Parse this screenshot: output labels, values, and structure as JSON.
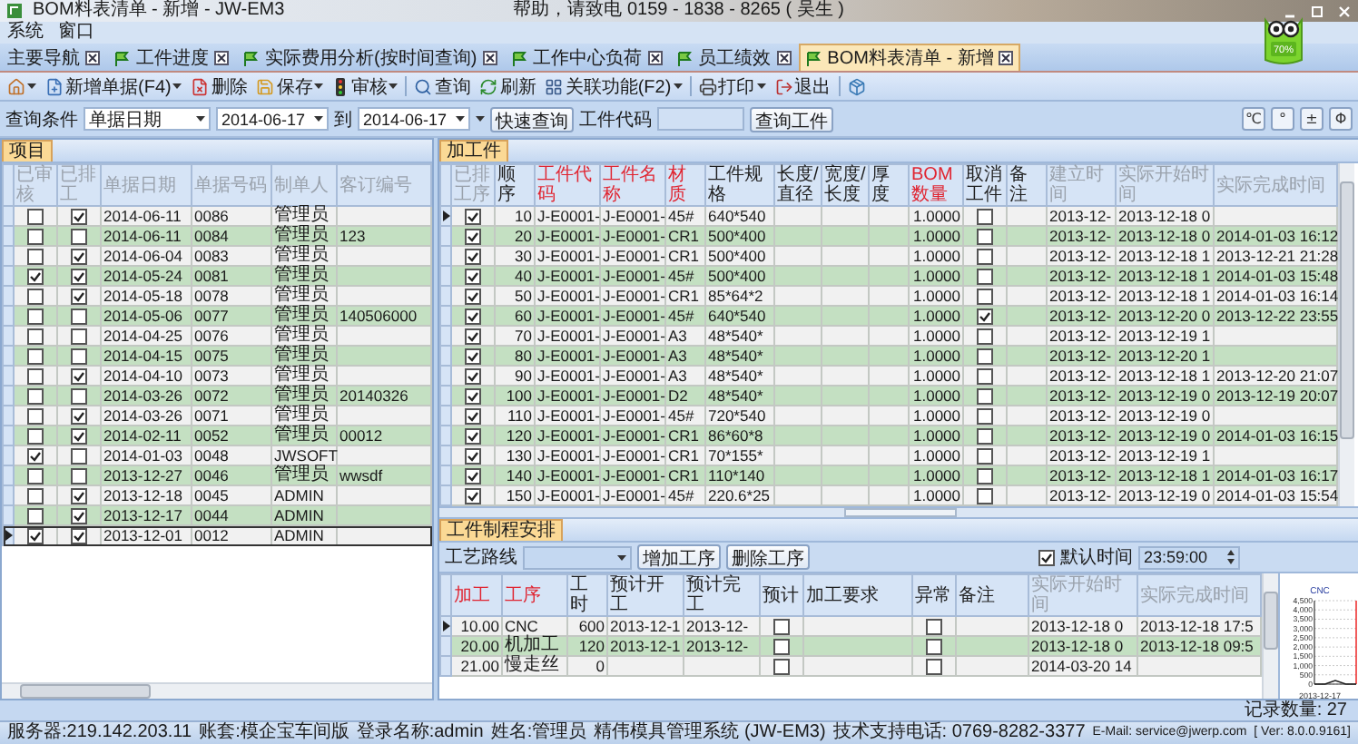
{
  "window": {
    "title": "BOM料表清单 - 新增 - JW-EM3",
    "help": "帮助，请致电 0159 - 1838 - 8265 ( 吴生 )"
  },
  "menu": [
    "系统",
    "窗口"
  ],
  "mascot": {
    "badge": "70%"
  },
  "tabs": [
    {
      "label": "主要导航",
      "icon": false,
      "selected": false
    },
    {
      "label": "工件进度",
      "icon": true,
      "selected": false
    },
    {
      "label": "实际费用分析(按时间查询)",
      "icon": true,
      "selected": false
    },
    {
      "label": "工作中心负荷",
      "icon": true,
      "selected": false
    },
    {
      "label": "员工绩效",
      "icon": true,
      "selected": false
    },
    {
      "label": "BOM料表清单 - 新增",
      "icon": true,
      "selected": true
    }
  ],
  "toolbar": [
    {
      "kind": "button",
      "menu": true
    },
    {
      "kind": "button",
      "label": "新增单据(F4)",
      "menu": true
    },
    {
      "kind": "button",
      "label": "删除",
      "menu": false
    },
    {
      "kind": "button",
      "label": "保存",
      "menu": true
    },
    {
      "kind": "button",
      "label": "审核",
      "menu": true
    },
    {
      "kind": "separator"
    },
    {
      "kind": "button",
      "label": "查询",
      "menu": false
    },
    {
      "kind": "button",
      "label": "刷新",
      "menu": false
    },
    {
      "kind": "button",
      "label": "关联功能(F2)",
      "menu": true
    },
    {
      "kind": "separator"
    },
    {
      "kind": "button",
      "label": "打印",
      "menu": true
    },
    {
      "kind": "button",
      "label": "退出",
      "menu": false
    },
    {
      "kind": "separator"
    },
    {
      "kind": "button",
      "menu": false
    }
  ],
  "query": {
    "label": "查询条件",
    "field": "单据日期",
    "from": "2014-06-17",
    "to_label": "到",
    "to": "2014-06-17",
    "quick_button": "快速查询",
    "code_label": "工件代码",
    "code_button": "查询工件",
    "tools": [
      "℃",
      "°",
      "±",
      "Φ"
    ]
  },
  "projects": {
    "tab": "项目",
    "columns": [
      {
        "label": "已审核",
        "color": "#9aa2ac"
      },
      {
        "label": "已排工",
        "color": "#9aa2ac"
      },
      {
        "label": "单据日期",
        "color": "#9aa2ac"
      },
      {
        "label": "单据号码",
        "color": "#9aa2ac"
      },
      {
        "label": "制单人",
        "color": "#9aa2ac"
      },
      {
        "label": "客订编号",
        "color": "#9aa2ac"
      }
    ],
    "rows": [
      {
        "selected": false,
        "approved": false,
        "scheduled": true,
        "date": "2014-06-11",
        "number": "0086",
        "maker": "管理员"
      },
      {
        "selected": false,
        "approved": false,
        "scheduled": false,
        "date": "2014-06-11",
        "number": "0084",
        "maker": "管理员",
        "order_no": "123"
      },
      {
        "selected": false,
        "approved": false,
        "scheduled": true,
        "date": "2014-06-04",
        "number": "0083",
        "maker": "管理员"
      },
      {
        "selected": false,
        "approved": true,
        "scheduled": true,
        "date": "2014-05-24",
        "number": "0081",
        "maker": "管理员"
      },
      {
        "selected": false,
        "approved": false,
        "scheduled": true,
        "date": "2014-05-18",
        "number": "0078",
        "maker": "管理员"
      },
      {
        "selected": false,
        "approved": false,
        "scheduled": false,
        "date": "2014-05-06",
        "number": "0077",
        "maker": "管理员",
        "order_no": "140506000"
      },
      {
        "selected": false,
        "approved": false,
        "scheduled": false,
        "date": "2014-04-25",
        "number": "0076",
        "maker": "管理员"
      },
      {
        "selected": false,
        "approved": false,
        "scheduled": false,
        "date": "2014-04-15",
        "number": "0075",
        "maker": "管理员"
      },
      {
        "selected": false,
        "approved": false,
        "scheduled": true,
        "date": "2014-04-10",
        "number": "0073",
        "maker": "管理员"
      },
      {
        "selected": false,
        "approved": false,
        "scheduled": false,
        "date": "2014-03-26",
        "number": "0072",
        "maker": "管理员",
        "order_no": "20140326"
      },
      {
        "selected": false,
        "approved": false,
        "scheduled": true,
        "date": "2014-03-26",
        "number": "0071",
        "maker": "管理员"
      },
      {
        "selected": false,
        "approved": false,
        "scheduled": true,
        "date": "2014-02-11",
        "number": "0052",
        "maker": "管理员",
        "order_no": "00012"
      },
      {
        "selected": false,
        "approved": true,
        "scheduled": false,
        "date": "2014-01-03",
        "number": "0048",
        "maker": "JWSOFT"
      },
      {
        "selected": false,
        "approved": false,
        "scheduled": false,
        "date": "2013-12-27",
        "number": "0046",
        "maker": "管理员",
        "order_no": "wwsdf"
      },
      {
        "selected": false,
        "approved": false,
        "scheduled": true,
        "date": "2013-12-18",
        "number": "0045",
        "maker": "ADMIN"
      },
      {
        "selected": false,
        "approved": false,
        "scheduled": true,
        "date": "2013-12-17",
        "number": "0044",
        "maker": "ADMIN"
      },
      {
        "selected": true,
        "approved": true,
        "scheduled": true,
        "date": "2013-12-01",
        "number": "0012",
        "maker": "ADMIN"
      }
    ]
  },
  "parts": {
    "tab": "加工件",
    "columns": [
      {
        "label": "已排工序",
        "color": "#9aa2ac"
      },
      {
        "label": "顺序",
        "color": "#1f1f1f"
      },
      {
        "label": "工件代码",
        "color": "#e02531"
      },
      {
        "label": "工件名称",
        "color": "#e02531"
      },
      {
        "label": "材质",
        "color": "#e02531"
      },
      {
        "label": "工件规格",
        "color": "#1f1f1f"
      },
      {
        "label": "长度/直径",
        "color": "#1f1f1f"
      },
      {
        "label": "宽度/长度",
        "color": "#1f1f1f"
      },
      {
        "label": "厚度",
        "color": "#1f1f1f"
      },
      {
        "label": "BOM数量",
        "color": "#e02531"
      },
      {
        "label": "取消工件",
        "color": "#1f1f1f"
      },
      {
        "label": "备注",
        "color": "#1f1f1f"
      },
      {
        "label": "建立时间",
        "color": "#9aa2ac"
      },
      {
        "label": "实际开始时间",
        "color": "#9aa2ac"
      },
      {
        "label": "实际完成时间",
        "color": "#9aa2ac"
      }
    ],
    "rows": [
      {
        "selected": true,
        "scheduled": true,
        "seq": "10",
        "code": "J-E0001-",
        "name": "J-E0001-",
        "material": "45#",
        "spec": "640*540",
        "bom_qty": "1.0000",
        "cancelled": false,
        "created": "2013-12-",
        "started": "2013-12-18 0"
      },
      {
        "selected": false,
        "scheduled": true,
        "seq": "20",
        "code": "J-E0001-",
        "name": "J-E0001-",
        "material": "CR1",
        "spec": "500*400",
        "bom_qty": "1.0000",
        "cancelled": false,
        "created": "2013-12-",
        "started": "2013-12-18 0",
        "finished": "2014-01-03 16:12"
      },
      {
        "selected": false,
        "scheduled": true,
        "seq": "30",
        "code": "J-E0001-",
        "name": "J-E0001-",
        "material": "CR1",
        "spec": "500*400",
        "bom_qty": "1.0000",
        "cancelled": false,
        "created": "2013-12-",
        "started": "2013-12-18 1",
        "finished": "2013-12-21 21:28"
      },
      {
        "selected": false,
        "scheduled": true,
        "seq": "40",
        "code": "J-E0001-",
        "name": "J-E0001-",
        "material": "45#",
        "spec": "500*400",
        "bom_qty": "1.0000",
        "cancelled": false,
        "created": "2013-12-",
        "started": "2013-12-18 1",
        "finished": "2014-01-03 15:48"
      },
      {
        "selected": false,
        "scheduled": true,
        "seq": "50",
        "code": "J-E0001-",
        "name": "J-E0001-",
        "material": "CR1",
        "spec": "85*64*2",
        "bom_qty": "1.0000",
        "cancelled": false,
        "created": "2013-12-",
        "started": "2013-12-18 1",
        "finished": "2014-01-03 16:14"
      },
      {
        "selected": false,
        "scheduled": true,
        "seq": "60",
        "code": "J-E0001-",
        "name": "J-E0001-",
        "material": "45#",
        "spec": "640*540",
        "bom_qty": "1.0000",
        "cancelled": true,
        "created": "2013-12-",
        "started": "2013-12-20 0",
        "finished": "2013-12-22 23:55"
      },
      {
        "selected": false,
        "scheduled": true,
        "seq": "70",
        "code": "J-E0001-",
        "name": "J-E0001-",
        "material": "A3",
        "spec": "48*540*",
        "bom_qty": "1.0000",
        "cancelled": false,
        "created": "2013-12-",
        "started": "2013-12-19 1"
      },
      {
        "selected": false,
        "scheduled": true,
        "seq": "80",
        "code": "J-E0001-",
        "name": "J-E0001-",
        "material": "A3",
        "spec": "48*540*",
        "bom_qty": "1.0000",
        "cancelled": false,
        "created": "2013-12-",
        "started": "2013-12-20 1"
      },
      {
        "selected": false,
        "scheduled": true,
        "seq": "90",
        "code": "J-E0001-",
        "name": "J-E0001-",
        "material": "A3",
        "spec": "48*540*",
        "bom_qty": "1.0000",
        "cancelled": false,
        "created": "2013-12-",
        "started": "2013-12-18 1",
        "finished": "2013-12-20 21:07"
      },
      {
        "selected": false,
        "scheduled": true,
        "seq": "100",
        "code": "J-E0001-",
        "name": "J-E0001-",
        "material": "D2",
        "spec": "48*540*",
        "bom_qty": "1.0000",
        "cancelled": false,
        "created": "2013-12-",
        "started": "2013-12-19 0",
        "finished": "2013-12-19 20:07"
      },
      {
        "selected": false,
        "scheduled": true,
        "seq": "110",
        "code": "J-E0001-",
        "name": "J-E0001-",
        "material": "45#",
        "spec": "720*540",
        "bom_qty": "1.0000",
        "cancelled": false,
        "created": "2013-12-",
        "started": "2013-12-19 0"
      },
      {
        "selected": false,
        "scheduled": true,
        "seq": "120",
        "code": "J-E0001-",
        "name": "J-E0001-",
        "material": "CR1",
        "spec": "86*60*8",
        "bom_qty": "1.0000",
        "cancelled": false,
        "created": "2013-12-",
        "started": "2013-12-19 0",
        "finished": "2014-01-03 16:15"
      },
      {
        "selected": false,
        "scheduled": true,
        "seq": "130",
        "code": "J-E0001-",
        "name": "J-E0001-",
        "material": "CR1",
        "spec": "70*155*",
        "bom_qty": "1.0000",
        "cancelled": false,
        "created": "2013-12-",
        "started": "2013-12-19 1"
      },
      {
        "selected": false,
        "scheduled": true,
        "seq": "140",
        "code": "J-E0001-",
        "name": "J-E0001-",
        "material": "CR1",
        "spec": "110*140",
        "bom_qty": "1.0000",
        "cancelled": false,
        "created": "2013-12-",
        "started": "2013-12-18 1",
        "finished": "2014-01-03 16:17"
      },
      {
        "selected": false,
        "scheduled": true,
        "seq": "150",
        "code": "J-E0001-",
        "name": "J-E0001-",
        "material": "45#",
        "spec": "220.6*25",
        "bom_qty": "1.0000",
        "cancelled": false,
        "created": "2013-12-",
        "started": "2013-12-19 0",
        "finished": "2014-01-03 15:54"
      }
    ]
  },
  "routing": {
    "tab": "工件制程安排",
    "route_label": "工艺路线",
    "add_button": "增加工序",
    "delete_button": "删除工序",
    "default_time": {
      "label": "默认时间",
      "checked": true
    },
    "time": "23:59:00",
    "columns": [
      {
        "label": "加工",
        "color": "#e02531"
      },
      {
        "label": "工序",
        "color": "#e02531"
      },
      {
        "label": "工时",
        "color": "#1f1f1f"
      },
      {
        "label": "预计开工",
        "color": "#1f1f1f"
      },
      {
        "label": "预计完工",
        "color": "#1f1f1f"
      },
      {
        "label": "预计",
        "color": "#1f1f1f"
      },
      {
        "label": "加工要求",
        "color": "#1f1f1f"
      },
      {
        "label": "异常",
        "color": "#1f1f1f"
      },
      {
        "label": "备注",
        "color": "#1f1f1f"
      },
      {
        "label": "实际开始时间",
        "color": "#9aa2ac"
      },
      {
        "label": "实际完成时间",
        "color": "#9aa2ac"
      }
    ],
    "rows": [
      {
        "selected": true,
        "step": "10.00",
        "process": "CNC",
        "hours": "600",
        "plan_start": "2013-12-1",
        "plan_end": "2013-12-",
        "planned": false,
        "abnormal": false,
        "started": "2013-12-18 0",
        "finished": "2013-12-18 17:5"
      },
      {
        "selected": false,
        "step": "20.00",
        "process": "机加工",
        "hours": "120",
        "plan_start": "2013-12-1",
        "plan_end": "2013-12-",
        "planned": false,
        "abnormal": false,
        "started": "2013-12-18 0",
        "finished": "2013-12-18 09:5"
      },
      {
        "selected": false,
        "step": "21.00",
        "process": "慢走丝",
        "hours": "0",
        "planned": false,
        "abnormal": false,
        "started": "2014-03-20 14"
      }
    ],
    "chart_data": {
      "type": "line",
      "xlabel": "2013-12-17",
      "grid": true,
      "ylim": [
        0,
        4500
      ],
      "yticks": [
        {
          "value": 0,
          "label": "0"
        },
        {
          "value": 500,
          "label": "500"
        },
        {
          "value": 1000,
          "label": "1,000"
        },
        {
          "value": 1500,
          "label": "1,500"
        },
        {
          "value": 2000,
          "label": "2,000"
        },
        {
          "value": 2500,
          "label": "2,500"
        },
        {
          "value": 3000,
          "label": "3,000"
        },
        {
          "value": 3500,
          "label": "3,500"
        },
        {
          "value": 4000,
          "label": "4,000"
        },
        {
          "value": 4500,
          "label": "4,500"
        }
      ],
      "series": [
        {
          "name": "CNC",
          "color": "#202020",
          "values": [
            0,
            0,
            200,
            0,
            0
          ]
        }
      ]
    }
  },
  "record_count": "记录数量: 27",
  "status_bar": [
    "服务器:219.142.203.11",
    "账套:模企宝车间版",
    "登录名称:admin",
    "姓名:管理员",
    "精伟模具管理系统 (JW-EM3)",
    "技术支持电话: 0769-8282-3377",
    "E-Mail: service@jwerp.com",
    "[ Ver: 8.0.0.9161]"
  ]
}
